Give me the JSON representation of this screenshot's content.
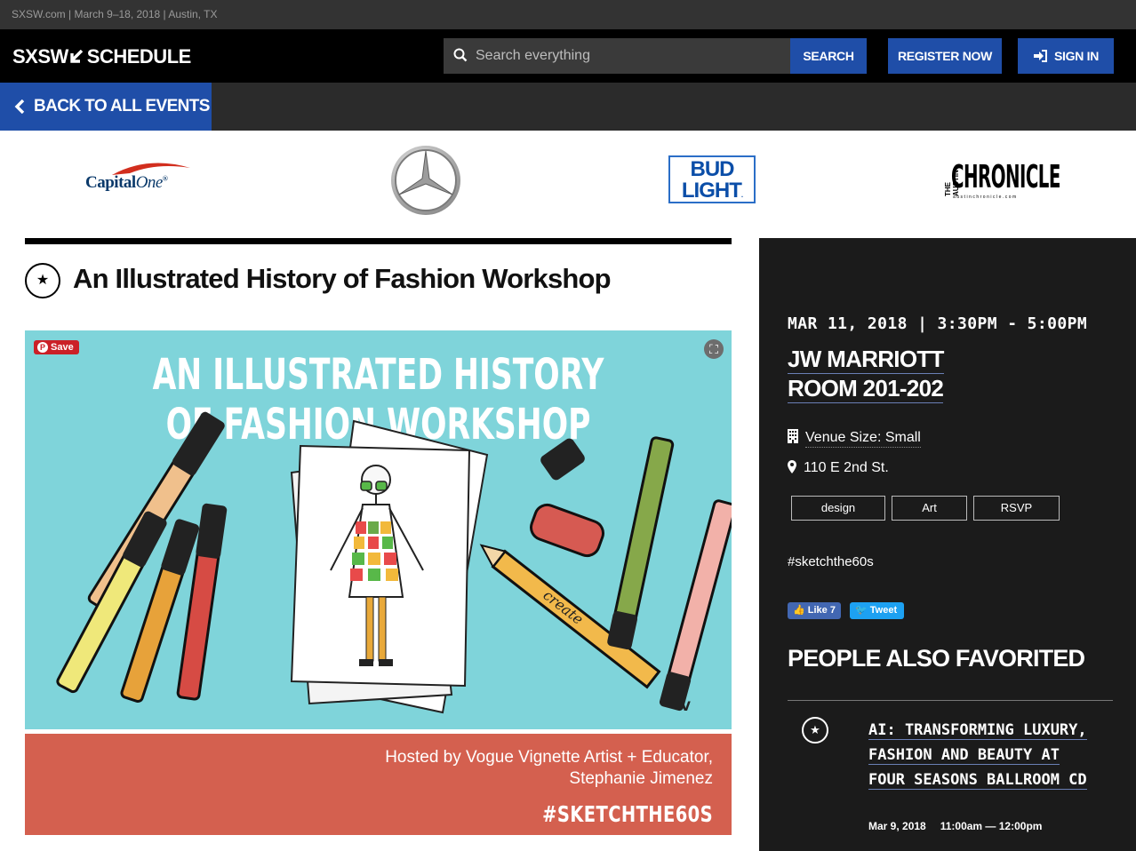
{
  "topbar": {
    "text": "SXSW.com | March 9–18, 2018 | Austin, TX"
  },
  "header": {
    "logo": "SXSW",
    "logo_suffix": "SCHEDULE",
    "search_placeholder": "Search everything",
    "search_button": "SEARCH",
    "register_button": "REGISTER NOW",
    "signin_button": "SIGN IN"
  },
  "nav": {
    "back_label": "BACK TO ALL EVENTS"
  },
  "sponsors": {
    "capital_one": "Capital One",
    "mercedes": "Mercedes-Benz",
    "bud_light": [
      "BUD",
      "LIGHT"
    ],
    "austin_chronicle": "CHRONICLE",
    "austin_chronicle_side": "THE AUSTIN",
    "austin_chronicle_url": "austinchronicle.com"
  },
  "event": {
    "title": "An Illustrated History of Fashion Workshop",
    "image_title": "AN ILLUSTRATED HISTORY OF FASHION WORKSHOP",
    "pin_save": "Save",
    "hosted_line1": "Hosted by Vogue Vignette Artist + Educator,",
    "hosted_line2": "Stephanie Jimenez",
    "image_hashtag": "#SKETCHTHE60S",
    "pencil_text": "create",
    "signature": "V"
  },
  "details": {
    "date": "MAR 11, 2018 | 3:30PM - 5:00PM",
    "venue_line1": "JW MARRIOTT",
    "venue_line2": "ROOM 201-202",
    "venue_size": "Venue Size: Small",
    "address": "110 E 2nd St.",
    "tags": [
      "design",
      "Art",
      "RSVP"
    ],
    "hashtag": "#sketchthe60s",
    "fb_like": "Like 7",
    "tweet": "Tweet",
    "also_favorited": "PEOPLE ALSO FAVORITED",
    "related": {
      "title": "AI: TRANSFORMING LUXURY, FASHION AND BEAUTY AT FOUR SEASONS BALLROOM CD",
      "date": "Mar 9, 2018",
      "time": "11:00am — 12:00pm"
    }
  }
}
